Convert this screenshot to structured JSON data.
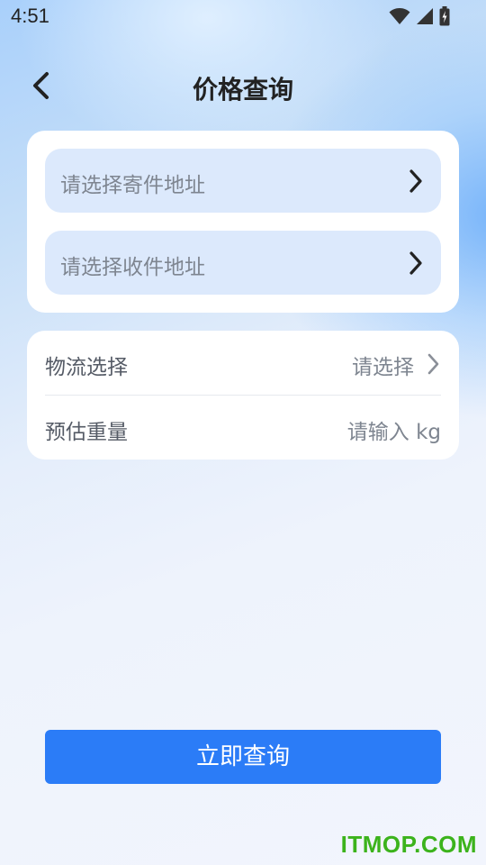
{
  "status_bar": {
    "time": "4:51",
    "icons": [
      "wifi-icon",
      "cellular-signal-icon",
      "battery-charging-icon"
    ]
  },
  "header": {
    "back_icon": "chevron-left-icon",
    "title": "价格查询"
  },
  "address_card": {
    "sender_placeholder": "请选择寄件地址",
    "receiver_placeholder": "请选择收件地址",
    "field_background": "#dce9fc"
  },
  "options_card": {
    "logistics_label": "物流选择",
    "logistics_value": "请选择",
    "weight_label": "预估重量",
    "weight_placeholder": "请输入 kg"
  },
  "query_button": {
    "label": "立即查询",
    "color": "#2b7cf7"
  },
  "watermark": {
    "text": "ITMOP.COM",
    "color": "#3cb31c"
  }
}
